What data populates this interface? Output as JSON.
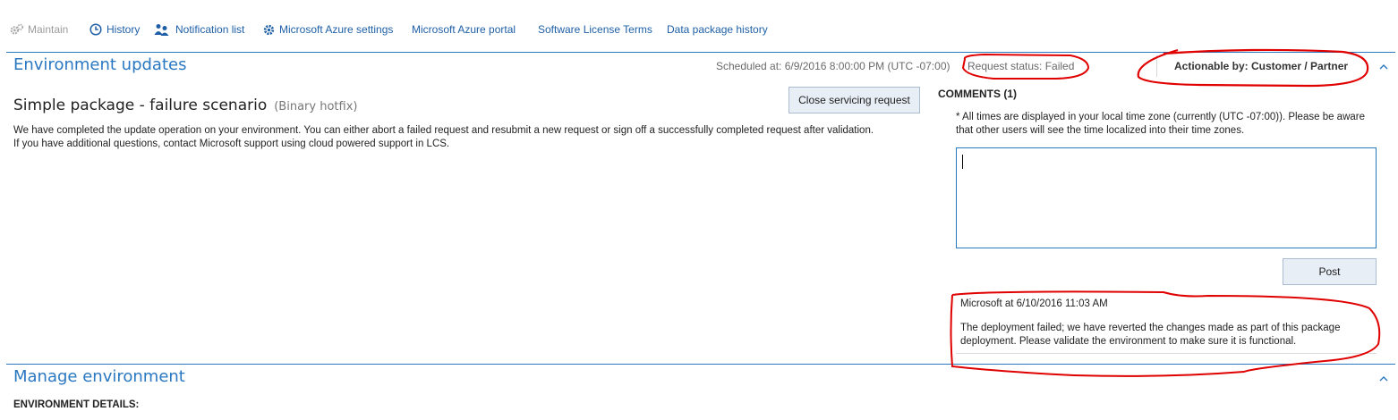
{
  "toolbar": {
    "items": [
      {
        "label": "Maintain",
        "icon": "gears-icon",
        "disabled": true
      },
      {
        "label": "History",
        "icon": "clock-icon"
      },
      {
        "label": "Notification list",
        "icon": "people-icon"
      },
      {
        "label": "Microsoft Azure settings",
        "icon": "gear-icon"
      },
      {
        "label": "Microsoft Azure portal"
      },
      {
        "label": "Software License Terms"
      },
      {
        "label": "Data package history"
      }
    ]
  },
  "env_updates": {
    "title": "Environment updates",
    "scheduled": "Scheduled at: 6/9/2016 8:00:00 PM (UTC -07:00)",
    "request_status": "Request status: Failed",
    "actionable_by": "Actionable by: Customer / Partner",
    "package_title": "Simple package - failure scenario",
    "package_type": "(Binary hotfix)",
    "description": "We have completed the update operation on your environment. You can either abort a failed request and resubmit a new request or sign off a successfully completed request after validation. If you have additional questions, contact Microsoft support using cloud powered support in LCS.",
    "close_button": "Close servicing request"
  },
  "comments": {
    "heading": "COMMENTS (1)",
    "timezone_note": "* All times are displayed in your local time zone (currently (UTC -07:00)). Please be aware that other users will see the time localized into their time zones.",
    "input_value": "",
    "post_button": "Post",
    "entries": [
      {
        "author_line": "Microsoft at 6/10/2016 11:03 AM",
        "text": "The deployment failed; we have reverted the changes made as part of this package deployment. Please validate the environment to make sure it is functional."
      }
    ]
  },
  "manage_env": {
    "title": "Manage environment",
    "details_heading": "ENVIRONMENT DETAILS:"
  },
  "colors": {
    "accent": "#2a78c2",
    "link": "#1e5fa6",
    "annotation": "#e00000"
  }
}
